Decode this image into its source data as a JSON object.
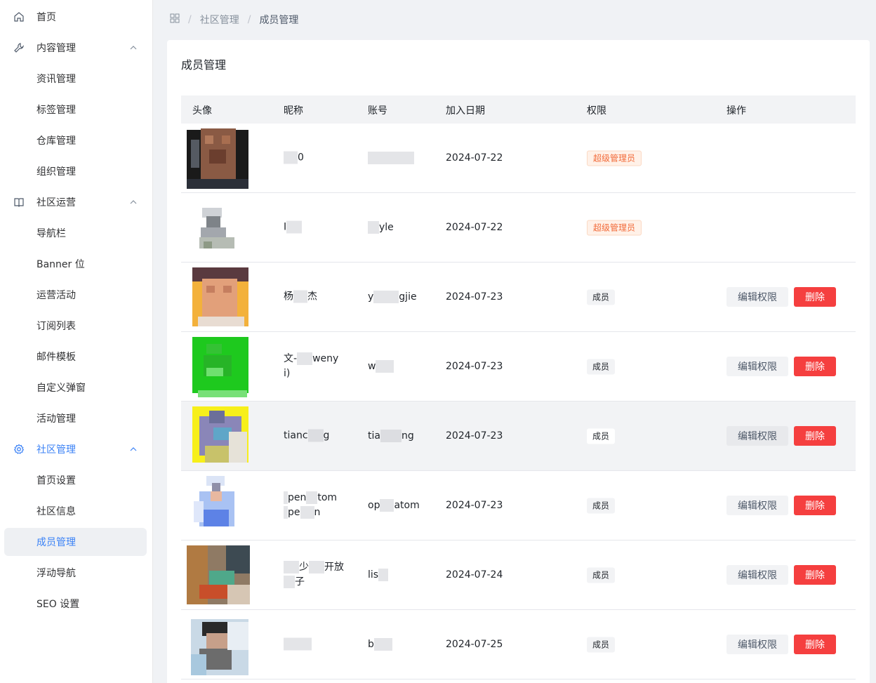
{
  "sidebar": {
    "items": [
      {
        "label": "首页",
        "type": "top",
        "icon": "home-icon"
      },
      {
        "label": "内容管理",
        "type": "group",
        "icon": "wrench-icon",
        "expanded": true
      },
      {
        "label": "资讯管理",
        "type": "sub"
      },
      {
        "label": "标签管理",
        "type": "sub"
      },
      {
        "label": "仓库管理",
        "type": "sub"
      },
      {
        "label": "组织管理",
        "type": "sub"
      },
      {
        "label": "社区运营",
        "type": "group",
        "icon": "book-icon",
        "expanded": true
      },
      {
        "label": "导航栏",
        "type": "sub"
      },
      {
        "label": "Banner 位",
        "type": "sub"
      },
      {
        "label": "运营活动",
        "type": "sub"
      },
      {
        "label": "订阅列表",
        "type": "sub"
      },
      {
        "label": "邮件模板",
        "type": "sub"
      },
      {
        "label": "自定义弹窗",
        "type": "sub"
      },
      {
        "label": "活动管理",
        "type": "sub"
      },
      {
        "label": "社区管理",
        "type": "group",
        "icon": "gear-icon",
        "expanded": true,
        "active": true
      },
      {
        "label": "首页设置",
        "type": "sub"
      },
      {
        "label": "社区信息",
        "type": "sub"
      },
      {
        "label": "成员管理",
        "type": "sub",
        "active": true
      },
      {
        "label": "浮动导航",
        "type": "sub"
      },
      {
        "label": "SEO 设置",
        "type": "sub"
      }
    ]
  },
  "breadcrumb": {
    "icon": "grid-icon",
    "items": [
      "社区管理",
      "成员管理"
    ],
    "separator": "/"
  },
  "page": {
    "title": "成员管理"
  },
  "table": {
    "columns": [
      "头像",
      "昵称",
      "账号",
      "加入日期",
      "权限",
      "操作"
    ],
    "rows": [
      {
        "nick_parts": [
          "",
          "0"
        ],
        "account_parts": [
          "",
          ""
        ],
        "date": "2024-07-22",
        "role": "超级管理员",
        "role_type": "super",
        "actions": false
      },
      {
        "nick_parts": [
          "",
          ""
        ],
        "account_parts": [
          "",
          "yle"
        ],
        "date": "2024-07-22",
        "role": "超级管理员",
        "role_type": "super",
        "actions": false
      },
      {
        "nick_parts": [
          "",
          "杰"
        ],
        "account_parts": [
          "y",
          "gjie"
        ],
        "date": "2024-07-23",
        "role": "成员",
        "role_type": "member",
        "actions": true
      },
      {
        "nick_parts": [
          "文-",
          "weny",
          "i)"
        ],
        "account_parts": [
          "w",
          ""
        ],
        "date": "2024-07-23",
        "role": "成员",
        "role_type": "member",
        "actions": true
      },
      {
        "nick_parts": [
          "tianc",
          "g"
        ],
        "account_parts": [
          "tia",
          "ng"
        ],
        "date": "2024-07-23",
        "role": "成员",
        "role_type": "member",
        "actions": true,
        "hover": true
      },
      {
        "nick_parts": [
          "pen",
          "tom",
          "pe",
          "n"
        ],
        "account_parts": [
          "op",
          "atom"
        ],
        "date": "2024-07-23",
        "role": "成员",
        "role_type": "member",
        "actions": true
      },
      {
        "nick_parts": [
          "",
          "开放",
          "子"
        ],
        "account_parts": [
          "lis",
          ""
        ],
        "date": "2024-07-24",
        "role": "成员",
        "role_type": "member",
        "actions": true
      },
      {
        "nick_parts": [
          "",
          ""
        ],
        "account_parts": [
          "b",
          ""
        ],
        "date": "2024-07-25",
        "role": "成员",
        "role_type": "member",
        "actions": true
      }
    ],
    "edit_label": "编辑权限",
    "delete_label": "删除"
  },
  "colors": {
    "accent": "#3b82f6",
    "danger": "#f53f3f",
    "super_tag": "#f26b3a"
  }
}
